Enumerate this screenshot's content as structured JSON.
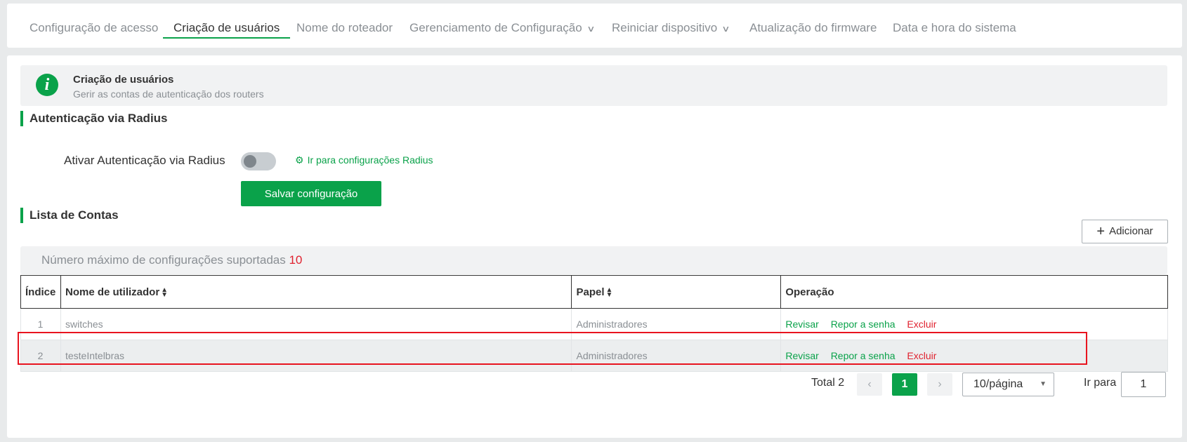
{
  "tabs": [
    {
      "label": "Configuração de acesso"
    },
    {
      "label": "Criação de usuários",
      "active": true
    },
    {
      "label": "Nome do roteador"
    },
    {
      "label": "Gerenciamento de Configuração",
      "dropdown": true
    },
    {
      "label": "Reiniciar dispositivo",
      "dropdown": true
    },
    {
      "label": "Atualização do firmware"
    },
    {
      "label": "Data e hora do sistema"
    }
  ],
  "info": {
    "icon": "info-icon",
    "title": "Criação de usuários",
    "description": "Gerir as contas de autenticação dos routers"
  },
  "radius": {
    "section_title": "Autenticação via Radius",
    "toggle_label": "Ativar Autenticação via Radius",
    "toggle_on": false,
    "link_icon": "gear-icon",
    "link_label": "Ir para configurações Radius",
    "save_label": "Salvar configuração"
  },
  "accounts": {
    "section_title": "Lista de Contas",
    "add_label": "Adicionar",
    "max_text": "Número máximo de configurações suportadas",
    "max_value": "10",
    "columns": [
      "Índice",
      "Nome de utilizador",
      "Papel",
      "Operação"
    ],
    "rows": [
      {
        "index": "1",
        "username": "switches",
        "role": "Administradores"
      },
      {
        "index": "2",
        "username": "testeIntelbras",
        "role": "Administradores",
        "highlighted": true
      }
    ],
    "operations": {
      "edit": "Revisar",
      "reset": "Repor a senha",
      "delete": "Excluir"
    }
  },
  "pagination": {
    "total": "Total 2",
    "current_page": "1",
    "page_size": "10/página",
    "goto_label": "Ir para",
    "goto_value": "1"
  },
  "colors": {
    "accent": "#0aa24a",
    "danger": "#e0222f",
    "highlight_border": "#e8141f"
  }
}
